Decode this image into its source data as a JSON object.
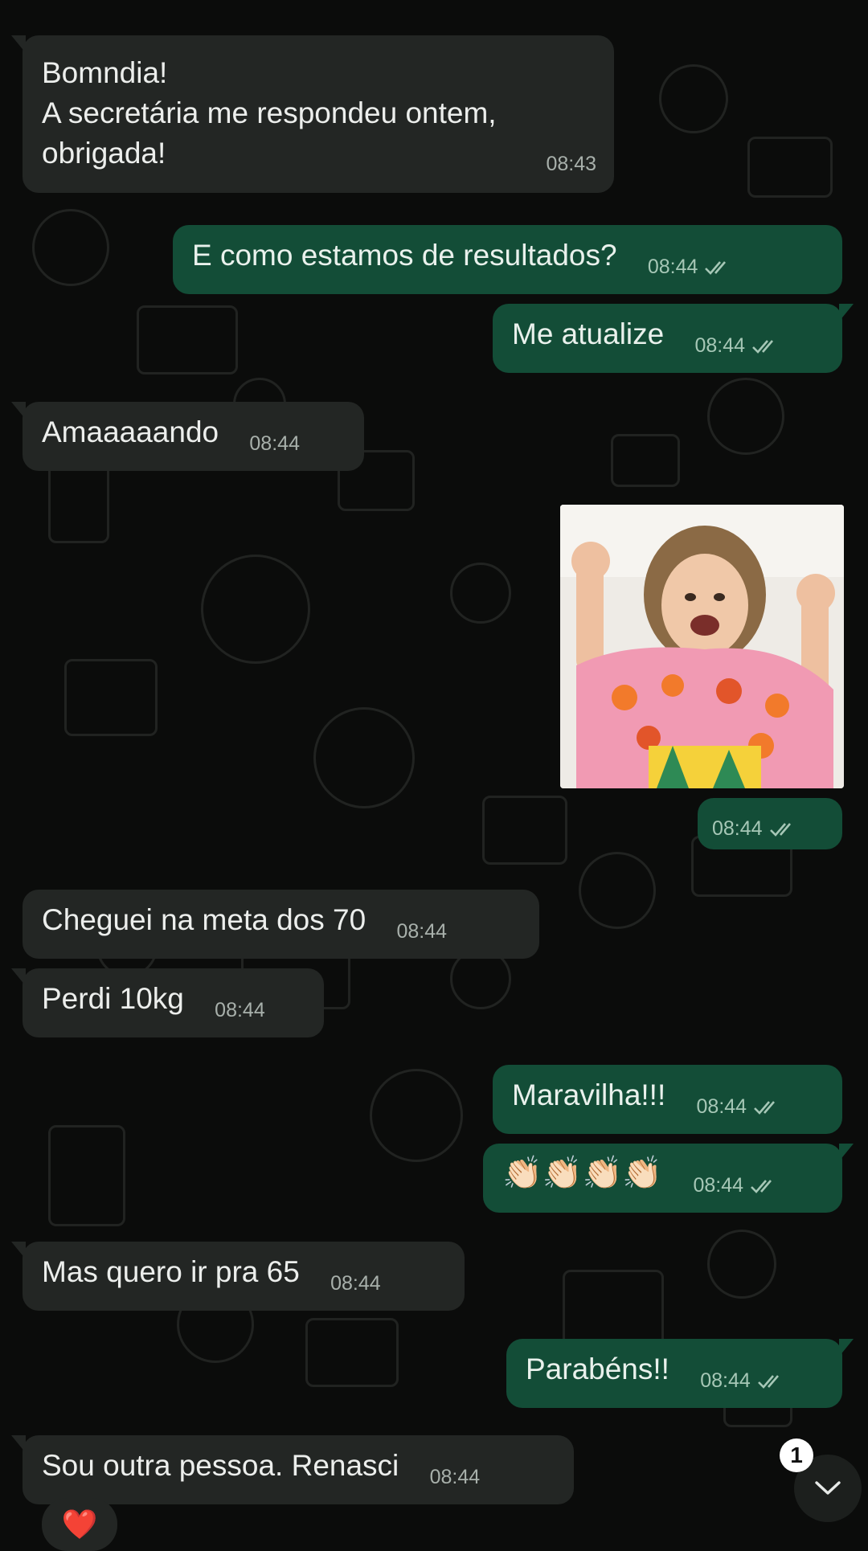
{
  "messages": [
    {
      "dir": "in",
      "text": "Bomndia!\nA secretária me respondeu ontem,\nobrigada!",
      "time": "08:43"
    },
    {
      "dir": "out",
      "text": "E como estamos de resultados?",
      "time": "08:44"
    },
    {
      "dir": "out",
      "text": "Me atualize",
      "time": "08:44"
    },
    {
      "dir": "in",
      "text": "Amaaaaando",
      "time": "08:44"
    },
    {
      "dir": "out",
      "type": "sticker",
      "time": "08:44"
    },
    {
      "dir": "in",
      "text": "Cheguei na meta dos 70",
      "time": "08:44"
    },
    {
      "dir": "in",
      "text": "Perdi 10kg",
      "time": "08:44"
    },
    {
      "dir": "out",
      "text": "Maravilha!!!",
      "time": "08:44"
    },
    {
      "dir": "out",
      "text": "👏🏻👏🏻👏🏻👏🏻",
      "time": "08:44"
    },
    {
      "dir": "in",
      "text": "Mas quero ir pra 65",
      "time": "08:44"
    },
    {
      "dir": "out",
      "text": "Parabéns!!",
      "time": "08:44"
    },
    {
      "dir": "in",
      "text": "Sou outra pessoa. Renasci",
      "time": "08:44"
    }
  ],
  "reaction": "❤️",
  "unread_count": "1",
  "colors": {
    "incoming": "#232624",
    "outgoing": "#134d37",
    "background": "#0b0c0b"
  }
}
